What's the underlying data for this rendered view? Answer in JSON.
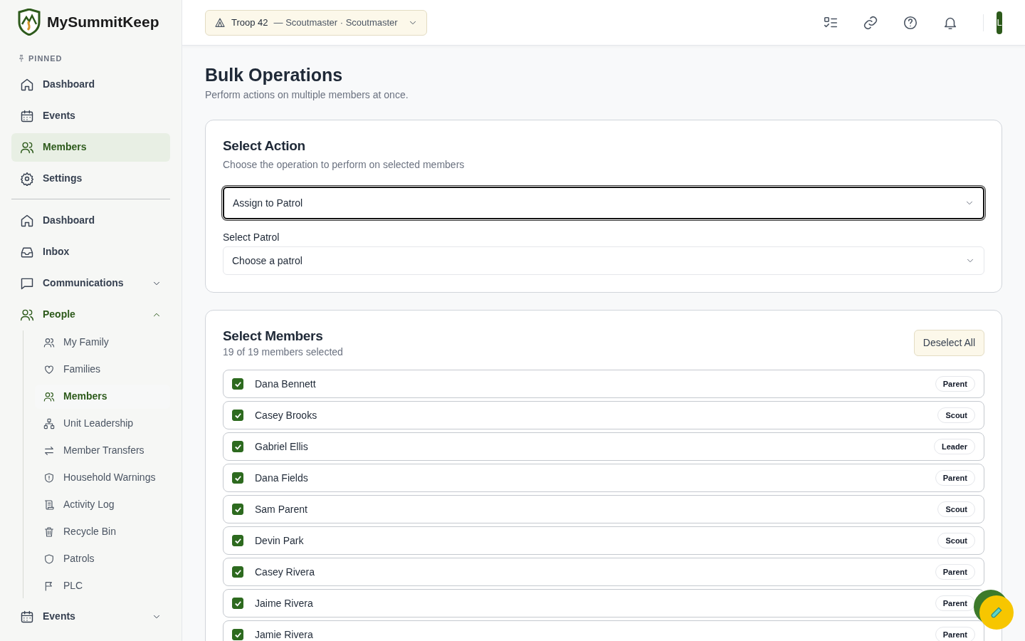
{
  "brand": {
    "name": "MySummitKeep"
  },
  "sidebar": {
    "pinned_label": "PINNED",
    "pinned": [
      {
        "label": "Dashboard",
        "selected": false
      },
      {
        "label": "Events",
        "selected": false
      },
      {
        "label": "Members",
        "selected": true
      },
      {
        "label": "Settings",
        "selected": false
      }
    ],
    "nav": [
      {
        "label": "Dashboard",
        "selected": false
      },
      {
        "label": "Inbox",
        "selected": false
      },
      {
        "label": "Communications",
        "selected": false,
        "expanded": false
      },
      {
        "label": "People",
        "selected": true,
        "expanded": true,
        "children": [
          {
            "label": "My Family",
            "selected": false
          },
          {
            "label": "Families",
            "selected": false
          },
          {
            "label": "Members",
            "selected": true
          },
          {
            "label": "Unit Leadership",
            "selected": false
          },
          {
            "label": "Member Transfers",
            "selected": false
          },
          {
            "label": "Household Warnings",
            "selected": false
          },
          {
            "label": "Activity Log",
            "selected": false
          },
          {
            "label": "Recycle Bin",
            "selected": false
          },
          {
            "label": "Patrols",
            "selected": false
          },
          {
            "label": "PLC",
            "selected": false
          }
        ]
      },
      {
        "label": "Events",
        "selected": false,
        "expanded": false
      }
    ]
  },
  "header": {
    "unit_selector": {
      "label": "Troop 42",
      "role": "— Scoutmaster · Scoutmaster"
    },
    "avatar": "L"
  },
  "page": {
    "title": "Bulk Operations",
    "subtitle": "Perform actions on multiple members at once."
  },
  "action_card": {
    "title": "Select Action",
    "subtitle": "Choose the operation to perform on selected members",
    "action": {
      "value": "Assign to Patrol"
    },
    "patrol_label": "Select Patrol",
    "patrol": {
      "value": "Choose a patrol"
    }
  },
  "members_card": {
    "title": "Select Members",
    "summary": "19 of 19 members selected",
    "button": "Deselect All",
    "members": [
      {
        "name": "Dana Bennett",
        "role": "Parent",
        "checked": true
      },
      {
        "name": "Casey Brooks",
        "role": "Scout",
        "checked": true
      },
      {
        "name": "Gabriel Ellis",
        "role": "Leader",
        "checked": true
      },
      {
        "name": "Dana Fields",
        "role": "Parent",
        "checked": true
      },
      {
        "name": "Sam Parent",
        "role": "Scout",
        "checked": true
      },
      {
        "name": "Devin Park",
        "role": "Scout",
        "checked": true
      },
      {
        "name": "Casey Rivera",
        "role": "Parent",
        "checked": true
      },
      {
        "name": "Jaime Rivera",
        "role": "Parent",
        "checked": true
      },
      {
        "name": "Jamie Rivera",
        "role": "Parent",
        "checked": true
      }
    ]
  }
}
